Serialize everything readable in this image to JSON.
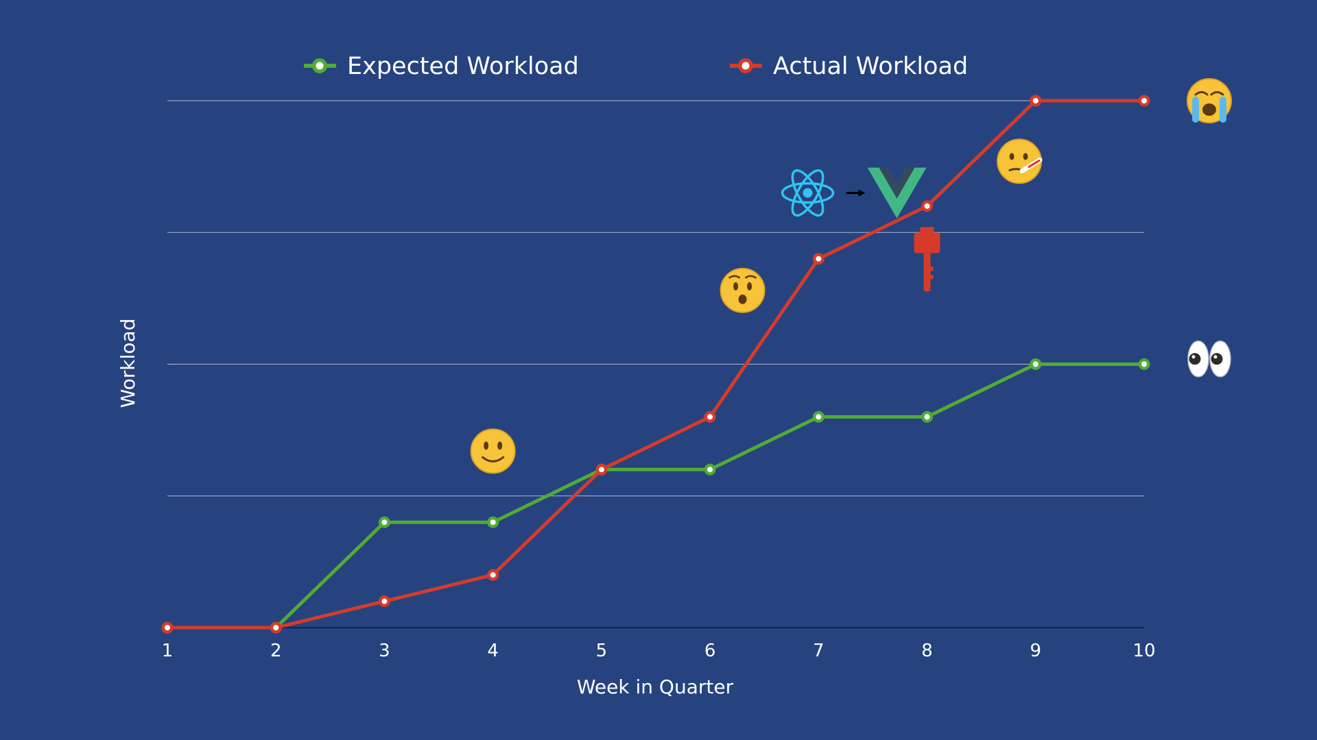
{
  "colors": {
    "background": "#26437f",
    "expected": "#4fac36",
    "actual": "#d63b2a",
    "grid": "#c8cfe0",
    "baseline": "#0b1a3a",
    "text": "#ffffff"
  },
  "chart_data": {
    "type": "line",
    "xlabel": "Week in Quarter",
    "ylabel": "Workload",
    "x": [
      1,
      2,
      3,
      4,
      5,
      6,
      7,
      8,
      9,
      10
    ],
    "xlim": [
      1,
      10
    ],
    "ylim": [
      0,
      20
    ],
    "y_gridlines": [
      0,
      5,
      10,
      15,
      20
    ],
    "y_tick_labels_shown": false,
    "grid": true,
    "legend_position": "top",
    "series": [
      {
        "name": "Expected Workload",
        "color": "#4fac36",
        "marker": "hollow-circle",
        "values": [
          0,
          0,
          4,
          4,
          6,
          6,
          8,
          8,
          10,
          10
        ]
      },
      {
        "name": "Actual Workload",
        "color": "#d63b2a",
        "marker": "hollow-circle",
        "values": [
          0,
          0,
          1,
          2,
          6,
          8,
          14,
          16,
          20,
          20
        ]
      }
    ],
    "annotations": [
      {
        "icon": "slightly-smiling-face-emoji",
        "x": 4,
        "y": 6.7
      },
      {
        "icon": "hushed-face-emoji",
        "x": 6.3,
        "y": 12.8
      },
      {
        "icon": "react-to-vue-icon",
        "x": 6.9,
        "y": 16.5
      },
      {
        "icon": "fire-extinguisher-icon",
        "x": 8,
        "y": 13.8
      },
      {
        "icon": "face-with-thermometer-emoji",
        "x": 8.85,
        "y": 17.7
      },
      {
        "icon": "loudly-crying-face-emoji",
        "x": 10.6,
        "y": 20
      },
      {
        "icon": "eyes-emoji",
        "x": 10.6,
        "y": 10.2
      }
    ]
  }
}
